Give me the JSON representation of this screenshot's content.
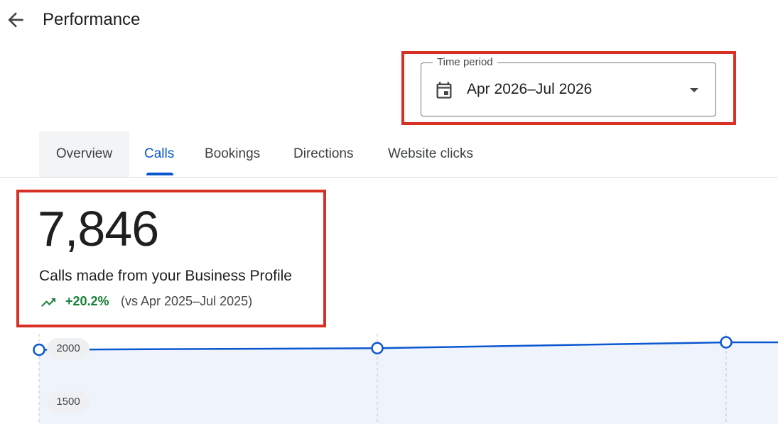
{
  "header": {
    "title": "Performance",
    "back_icon": "arrow-back-icon"
  },
  "time_period": {
    "label": "Time period",
    "value": "Apr 2026–Jul 2026",
    "icon": "calendar-icon",
    "dropdown_icon": "arrow-drop-down-icon"
  },
  "tabs": [
    {
      "label": "Overview"
    },
    {
      "label": "Calls",
      "selected": true
    },
    {
      "label": "Bookings"
    },
    {
      "label": "Directions"
    },
    {
      "label": "Website clicks"
    }
  ],
  "metric": {
    "value": "7,846",
    "label": "Calls made from your Business Profile",
    "change": "+20.2%",
    "comparison": "(vs Apr 2025–Jul 2025)",
    "trend_icon": "trending-up-icon"
  },
  "colors": {
    "accent": "#0b57d0",
    "positive": "#188038",
    "highlight": "#d93025"
  },
  "chart_data": {
    "type": "line",
    "y_ticks": [
      "2000",
      "1500"
    ],
    "series": [
      {
        "values": [
          1990,
          2005,
          2060,
          2060
        ]
      }
    ]
  }
}
